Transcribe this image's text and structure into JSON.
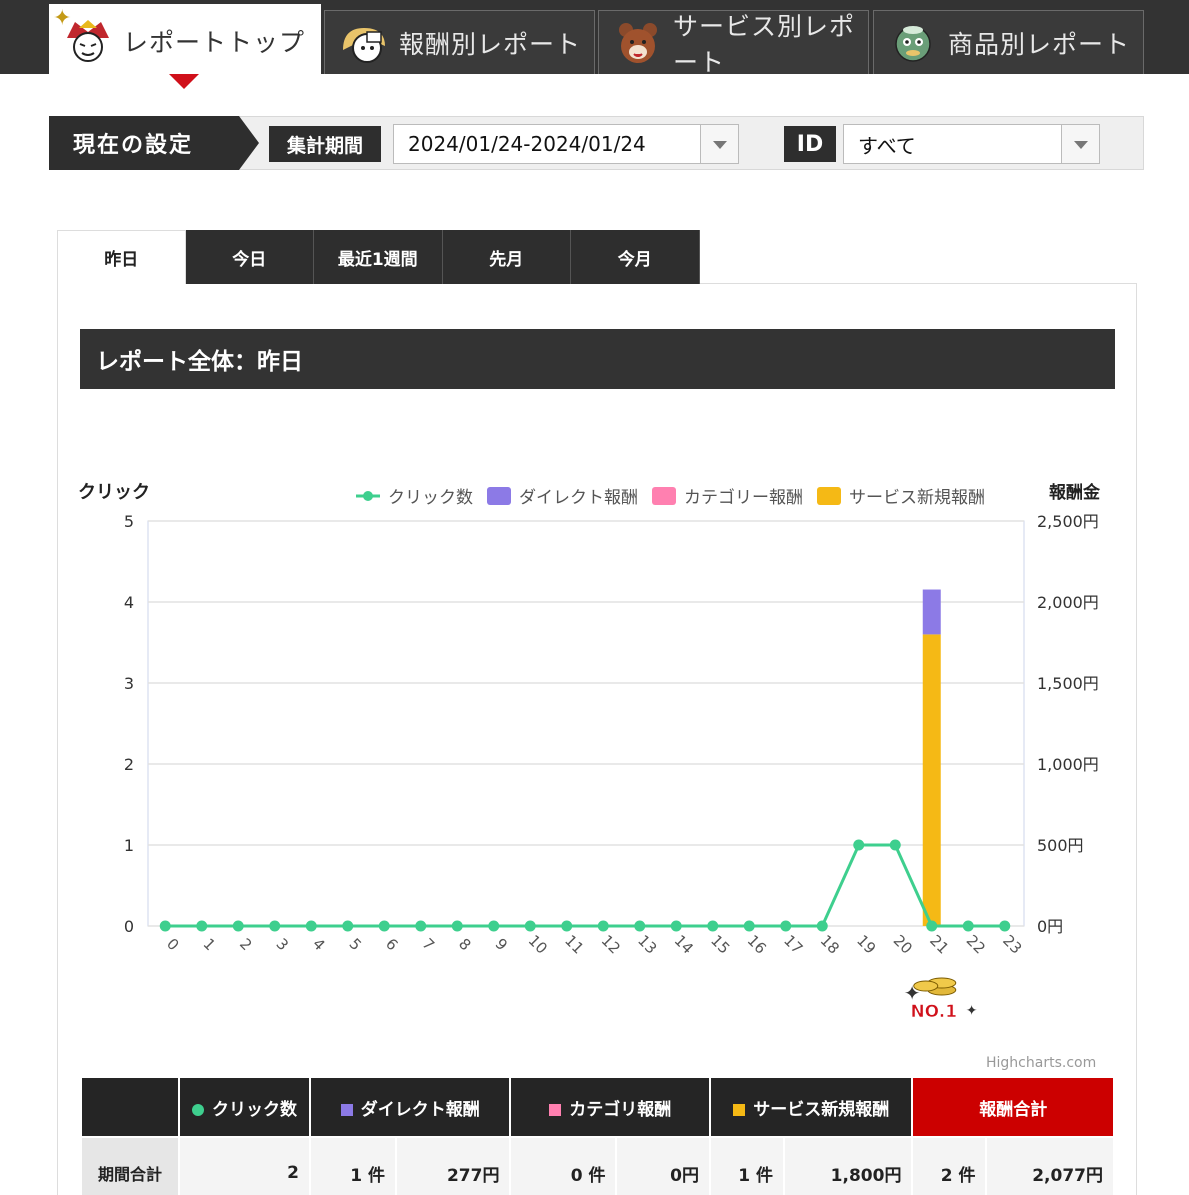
{
  "nav": {
    "tabs": [
      {
        "label": "レポートトップ",
        "icon": "samurai-mascot-icon",
        "active": true
      },
      {
        "label": "報酬別レポート",
        "icon": "girl-mascot-icon",
        "active": false
      },
      {
        "label": "サービス別レポート",
        "icon": "bear-mascot-icon",
        "active": false
      },
      {
        "label": "商品別レポート",
        "icon": "kappa-mascot-icon",
        "active": false
      }
    ]
  },
  "settings": {
    "label": "現在の設定",
    "period_label": "集計期間",
    "period_value": "2024/01/24-2024/01/24",
    "id_label": "ID",
    "id_value": "すべて"
  },
  "period_tabs": [
    {
      "label": "昨日",
      "active": true
    },
    {
      "label": "今日",
      "active": false
    },
    {
      "label": "最近1週間",
      "active": false
    },
    {
      "label": "先月",
      "active": false
    },
    {
      "label": "今月",
      "active": false
    }
  ],
  "section_title": "レポート全体：昨日",
  "chart_data": {
    "type": "bar",
    "left_axis_title": "クリック",
    "right_axis_title": "報酬金",
    "categories": [
      "0",
      "1",
      "2",
      "3",
      "4",
      "5",
      "6",
      "7",
      "8",
      "9",
      "10",
      "11",
      "12",
      "13",
      "14",
      "15",
      "16",
      "17",
      "18",
      "19",
      "20",
      "21",
      "22",
      "23"
    ],
    "left_ylim": [
      0,
      5
    ],
    "left_ticks": [
      "0",
      "1",
      "2",
      "3",
      "4",
      "5"
    ],
    "right_ylim": [
      0,
      2500
    ],
    "right_ticks": [
      "0円",
      "500円",
      "1,000円",
      "1,500円",
      "2,000円",
      "2,500円"
    ],
    "legend_position": "top-right",
    "series": [
      {
        "name": "クリック数",
        "kind": "line",
        "axis": "left",
        "color": "#3ecf8e",
        "values": [
          0,
          0,
          0,
          0,
          0,
          0,
          0,
          0,
          0,
          0,
          0,
          0,
          0,
          0,
          0,
          0,
          0,
          0,
          0,
          1,
          1,
          0,
          0,
          0
        ]
      },
      {
        "name": "ダイレクト報酬",
        "kind": "stacked-bar",
        "axis": "right",
        "color": "#8c7ae6",
        "values": [
          0,
          0,
          0,
          0,
          0,
          0,
          0,
          0,
          0,
          0,
          0,
          0,
          0,
          0,
          0,
          0,
          0,
          0,
          0,
          0,
          0,
          277,
          0,
          0
        ]
      },
      {
        "name": "カテゴリー報酬",
        "kind": "stacked-bar",
        "axis": "right",
        "color": "#ff80b0",
        "values": [
          0,
          0,
          0,
          0,
          0,
          0,
          0,
          0,
          0,
          0,
          0,
          0,
          0,
          0,
          0,
          0,
          0,
          0,
          0,
          0,
          0,
          0,
          0,
          0
        ]
      },
      {
        "name": "サービス新規報酬",
        "kind": "stacked-bar",
        "axis": "right",
        "color": "#f5b915",
        "values": [
          0,
          0,
          0,
          0,
          0,
          0,
          0,
          0,
          0,
          0,
          0,
          0,
          0,
          0,
          0,
          0,
          0,
          0,
          0,
          0,
          0,
          1800,
          0,
          0
        ]
      }
    ],
    "badge": {
      "category": "21",
      "text": "NO.1"
    },
    "credit": "Highcharts.com"
  },
  "summary": {
    "headers": [
      {
        "label": "クリック数",
        "color": "#3ecf8e",
        "shape": "circle"
      },
      {
        "label": "ダイレクト報酬",
        "color": "#8c7ae6",
        "shape": "square"
      },
      {
        "label": "カテゴリ報酬",
        "color": "#ff80b0",
        "shape": "square"
      },
      {
        "label": "サービス新規報酬",
        "color": "#f5b915",
        "shape": "square"
      },
      {
        "label": "報酬合計",
        "color": "#cc0000",
        "shape": "none"
      }
    ],
    "row": {
      "label": "期間合計",
      "clicks": "2",
      "direct_count": "1 件",
      "direct_amount": "277円",
      "category_count": "0 件",
      "category_amount": "0円",
      "service_count": "1 件",
      "service_amount": "1,800円",
      "total_count": "2 件",
      "total_amount": "2,077円"
    }
  }
}
